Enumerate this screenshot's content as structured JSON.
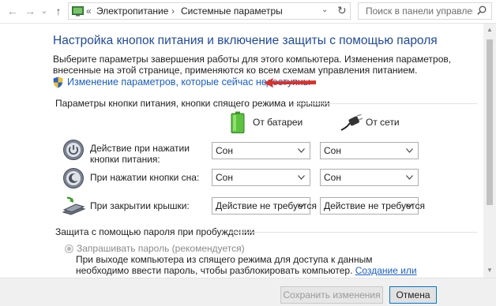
{
  "address_bar": {
    "back": "←",
    "forward": "→",
    "recent": "⌄",
    "up": "↑",
    "overflow": "«",
    "crumbs": [
      "Электропитание",
      "Системные параметры"
    ],
    "separator": "›",
    "dropdown_glyph": "⌄",
    "refresh_glyph": "↻",
    "search_placeholder": "Поиск в панели управления"
  },
  "header": {
    "title": "Настройка кнопок питания и включение защиты с помощью пароля",
    "description": "Выберите параметры завершения работы для этого компьютера. Изменения параметров, внесенные на этой странице, применяются ко всем схемам управления питанием.",
    "change_link": "Изменение параметров, которые сейчас недоступны"
  },
  "buttons_section": {
    "title": "Параметры кнопки питания, кнопки спящего режима и крышки",
    "col_battery": "От батареи",
    "col_ac": "От сети",
    "rows": [
      {
        "label": "Действие при нажатии кнопки питания:",
        "battery": "Сон",
        "ac": "Сон",
        "icon": "power-button-icon"
      },
      {
        "label": "При нажатии кнопки сна:",
        "battery": "Сон",
        "ac": "Сон",
        "icon": "sleep-button-icon"
      },
      {
        "label": "При закрытии крышки:",
        "battery": "Действие не требуется",
        "ac": "Действие не требуется",
        "icon": "laptop-lid-icon"
      }
    ]
  },
  "password_section": {
    "title": "Защита с помощью пароля при пробуждении",
    "radio_label": "Запрашивать пароль (рекомендуется)",
    "radio_desc": "При выходе компьютера из спящего режима для доступа к данным необходимо ввести пароль, чтобы разблокировать компьютер.",
    "radio_link": "Создание или изменение пароля учетной записи"
  },
  "footer": {
    "save": "Сохранить изменения",
    "cancel": "Отмена"
  },
  "colors": {
    "title_blue": "#1f4a9c",
    "link_blue": "#1a5ec7",
    "arrow_red": "#d8342a"
  }
}
